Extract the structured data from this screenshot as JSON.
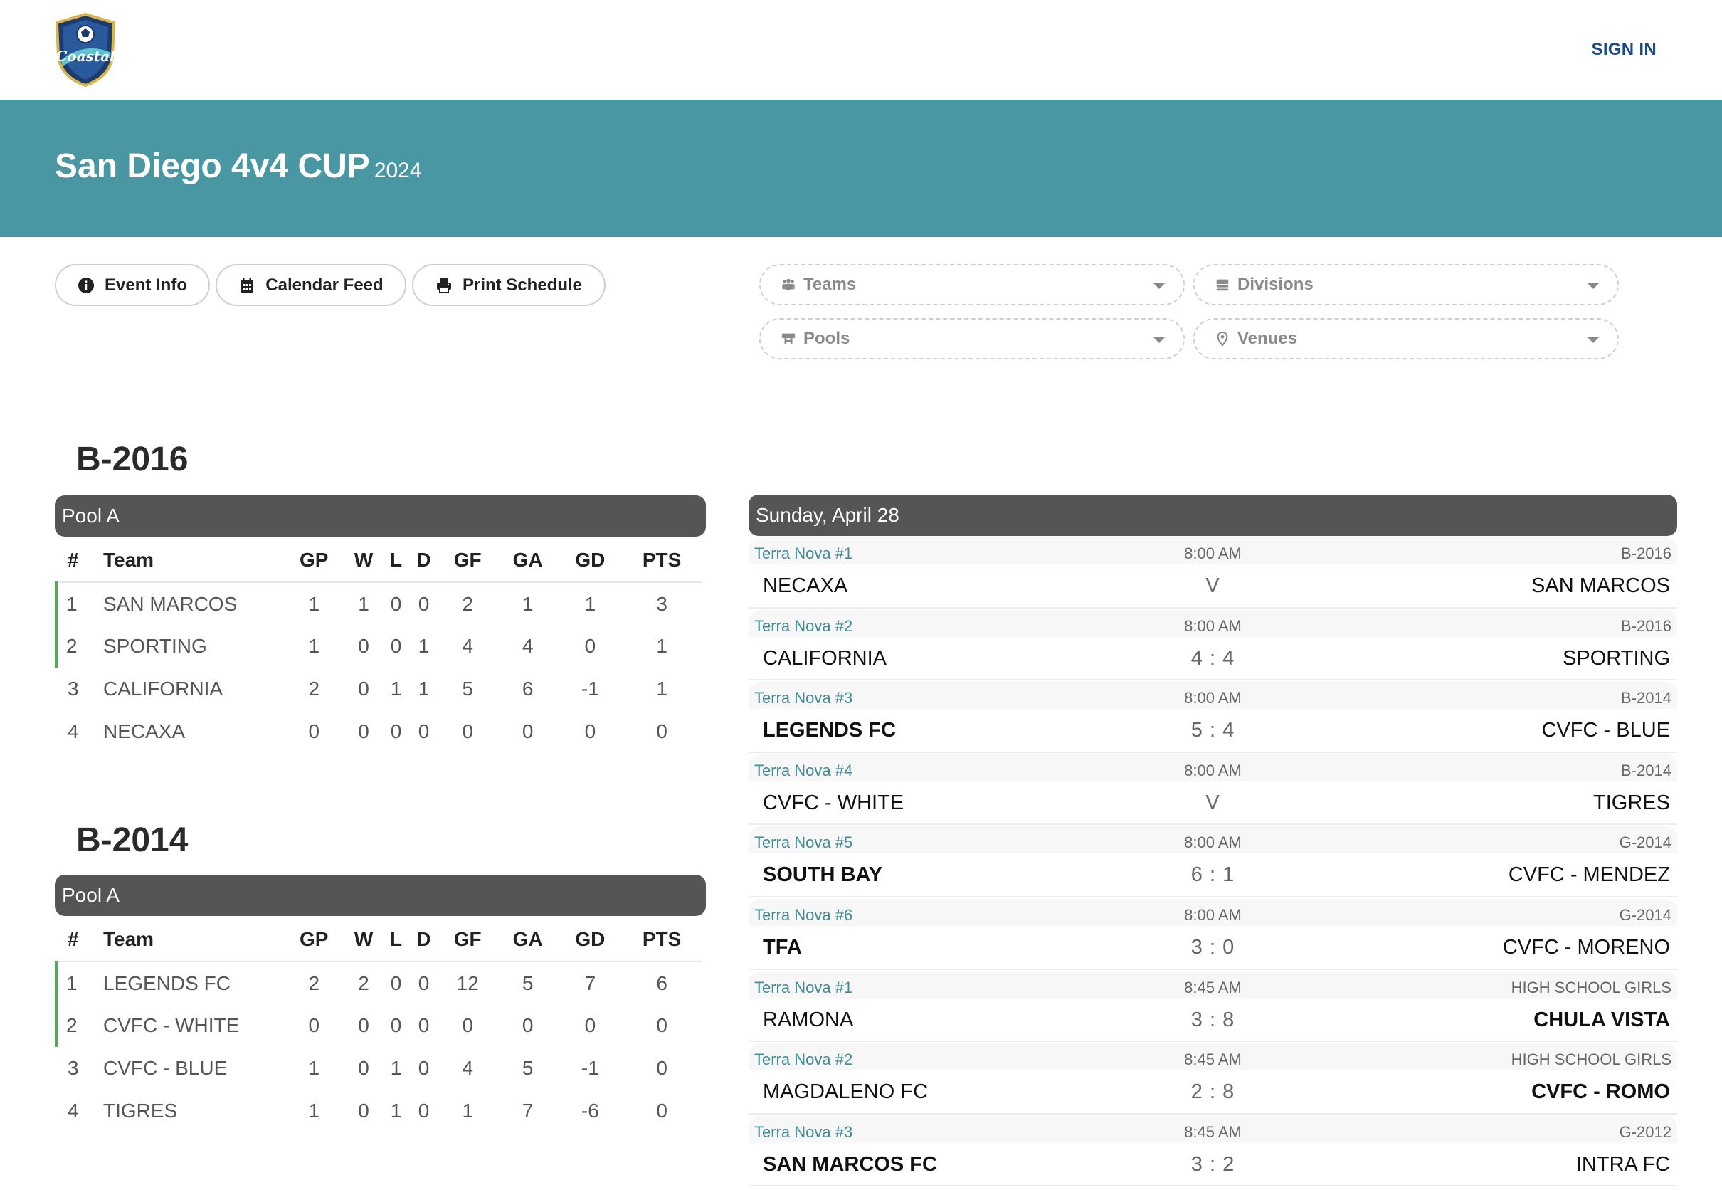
{
  "header": {
    "logo_text": "Coastal",
    "signin_label": "SIGN IN"
  },
  "banner": {
    "title": "San Diego 4v4 CUP",
    "year": "2024"
  },
  "toolbar": {
    "event_info": "Event Info",
    "calendar_feed": "Calendar Feed",
    "print_schedule": "Print Schedule"
  },
  "filters": {
    "teams": "Teams",
    "divisions": "Divisions",
    "pools": "Pools",
    "venues": "Venues"
  },
  "colors": {
    "banner": "#4897a2",
    "pool_header": "#555555",
    "venue_text": "#3d8c97",
    "qualifier_bar": "#4caf50",
    "signin": "#1a4a8a"
  },
  "standings_columns": [
    "#",
    "Team",
    "GP",
    "W",
    "L",
    "D",
    "GF",
    "GA",
    "GD",
    "PTS"
  ],
  "divisions": [
    {
      "name": "B-2016",
      "pool": "Pool A",
      "rows": [
        {
          "rank": "1",
          "team": "SAN MARCOS",
          "gp": "1",
          "w": "1",
          "l": "0",
          "d": "0",
          "gf": "2",
          "ga": "1",
          "gd": "1",
          "pts": "3"
        },
        {
          "rank": "2",
          "team": "SPORTING",
          "gp": "1",
          "w": "0",
          "l": "0",
          "d": "1",
          "gf": "4",
          "ga": "4",
          "gd": "0",
          "pts": "1"
        },
        {
          "rank": "3",
          "team": "CALIFORNIA",
          "gp": "2",
          "w": "0",
          "l": "1",
          "d": "1",
          "gf": "5",
          "ga": "6",
          "gd": "-1",
          "pts": "1"
        },
        {
          "rank": "4",
          "team": "NECAXA",
          "gp": "0",
          "w": "0",
          "l": "0",
          "d": "0",
          "gf": "0",
          "ga": "0",
          "gd": "0",
          "pts": "0"
        }
      ]
    },
    {
      "name": "B-2014",
      "pool": "Pool A",
      "rows": [
        {
          "rank": "1",
          "team": "LEGENDS FC",
          "gp": "2",
          "w": "2",
          "l": "0",
          "d": "0",
          "gf": "12",
          "ga": "5",
          "gd": "7",
          "pts": "6"
        },
        {
          "rank": "2",
          "team": "CVFC - WHITE",
          "gp": "0",
          "w": "0",
          "l": "0",
          "d": "0",
          "gf": "0",
          "ga": "0",
          "gd": "0",
          "pts": "0"
        },
        {
          "rank": "3",
          "team": "CVFC - BLUE",
          "gp": "1",
          "w": "0",
          "l": "1",
          "d": "0",
          "gf": "4",
          "ga": "5",
          "gd": "-1",
          "pts": "0"
        },
        {
          "rank": "4",
          "team": "TIGRES",
          "gp": "1",
          "w": "0",
          "l": "1",
          "d": "0",
          "gf": "1",
          "ga": "7",
          "gd": "-6",
          "pts": "0"
        }
      ]
    }
  ],
  "schedule": {
    "date": "Sunday, April 28",
    "games": [
      {
        "venue": "Terra Nova #1",
        "time": "8:00 AM",
        "division": "B-2016",
        "home": "NECAXA",
        "score": "V",
        "away": "SAN MARCOS",
        "winner": ""
      },
      {
        "venue": "Terra Nova #2",
        "time": "8:00 AM",
        "division": "B-2016",
        "home": "CALIFORNIA",
        "score": "4 : 4",
        "away": "SPORTING",
        "winner": ""
      },
      {
        "venue": "Terra Nova #3",
        "time": "8:00 AM",
        "division": "B-2014",
        "home": "LEGENDS FC",
        "score": "5 : 4",
        "away": "CVFC - BLUE",
        "winner": "home"
      },
      {
        "venue": "Terra Nova #4",
        "time": "8:00 AM",
        "division": "B-2014",
        "home": "CVFC - WHITE",
        "score": "V",
        "away": "TIGRES",
        "winner": ""
      },
      {
        "venue": "Terra Nova #5",
        "time": "8:00 AM",
        "division": "G-2014",
        "home": "SOUTH BAY",
        "score": "6 : 1",
        "away": "CVFC - MENDEZ",
        "winner": "home"
      },
      {
        "venue": "Terra Nova #6",
        "time": "8:00 AM",
        "division": "G-2014",
        "home": "TFA",
        "score": "3 : 0",
        "away": "CVFC - MORENO",
        "winner": "home"
      },
      {
        "venue": "Terra Nova #1",
        "time": "8:45 AM",
        "division": "HIGH SCHOOL GIRLS",
        "home": "RAMONA",
        "score": "3 : 8",
        "away": "CHULA VISTA",
        "winner": "away"
      },
      {
        "venue": "Terra Nova #2",
        "time": "8:45 AM",
        "division": "HIGH SCHOOL GIRLS",
        "home": "MAGDALENO FC",
        "score": "2 : 8",
        "away": "CVFC - ROMO",
        "winner": "away"
      },
      {
        "venue": "Terra Nova #3",
        "time": "8:45 AM",
        "division": "G-2012",
        "home": "SAN MARCOS FC",
        "score": "3 : 2",
        "away": "INTRA FC",
        "winner": "home"
      }
    ]
  }
}
